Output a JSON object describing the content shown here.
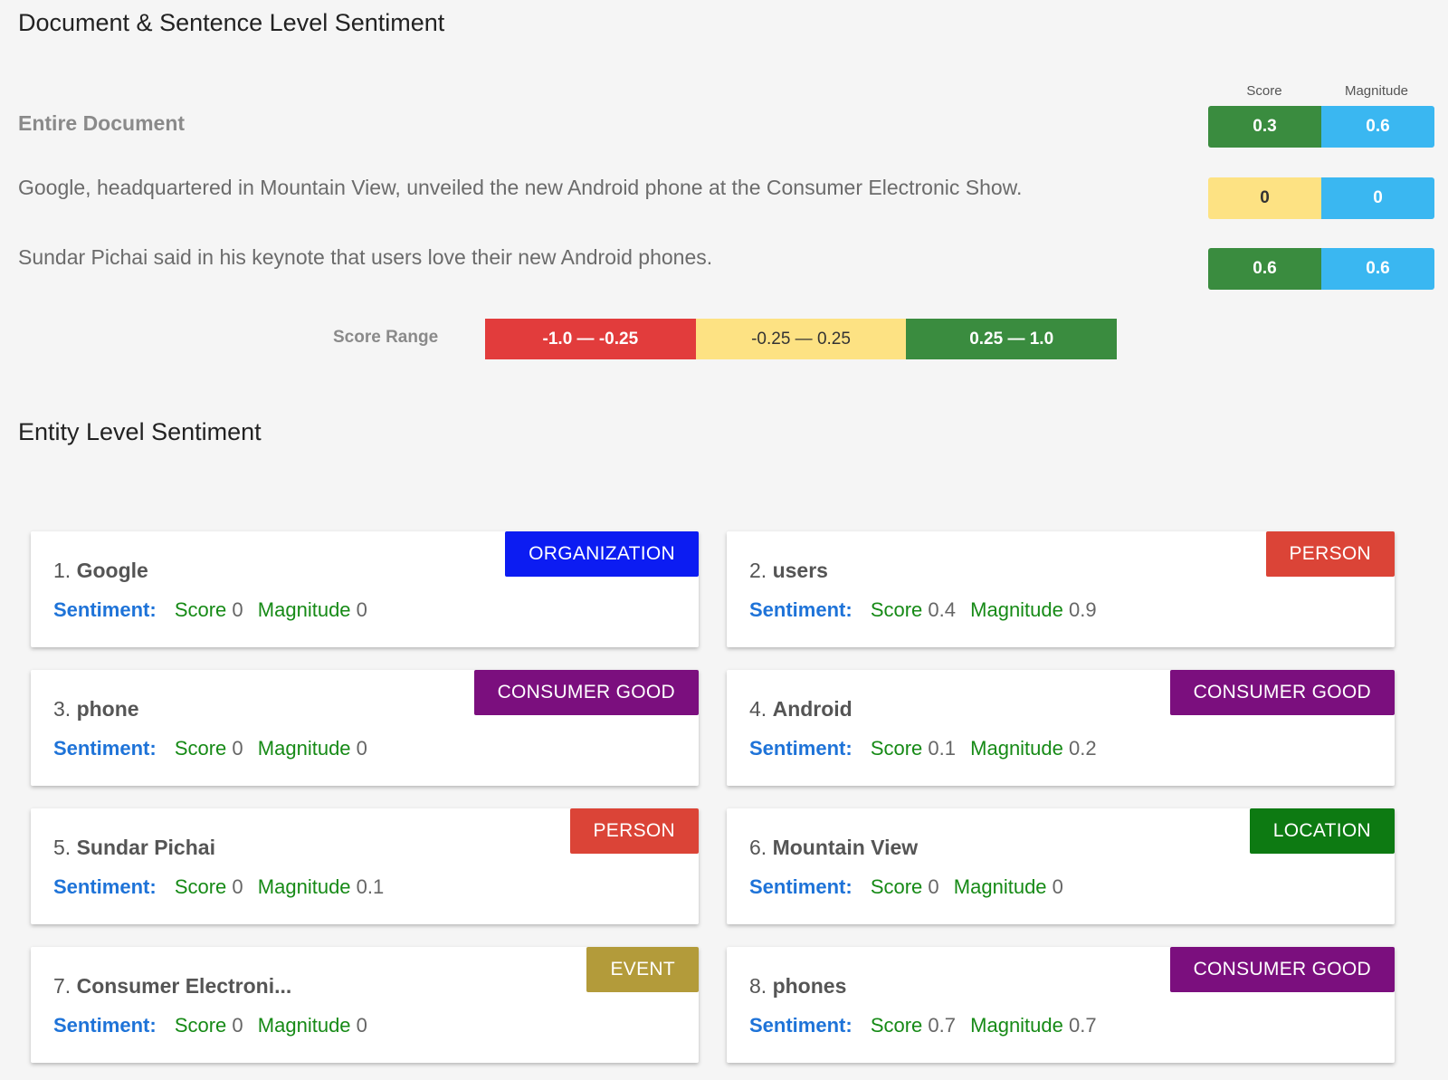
{
  "doc_section": {
    "title": "Document & Sentence Level Sentiment",
    "score_header": "Score",
    "magnitude_header": "Magnitude",
    "entire_document": {
      "label": "Entire Document",
      "score": "0.3",
      "magnitude": "0.6",
      "score_color": "#3a8c3f"
    },
    "sentences": [
      {
        "text": "Google, headquartered in Mountain View, unveiled the new Android phone at the Consumer Electronic Show.",
        "score": "0",
        "magnitude": "0",
        "score_color": "#fde283"
      },
      {
        "text": "Sundar Pichai said in his keynote that users love their new Android phones.",
        "score": "0.6",
        "magnitude": "0.6",
        "score_color": "#3a8c3f"
      }
    ],
    "score_range": {
      "label": "Score Range",
      "negative": "-1.0 — -0.25",
      "neutral": "-0.25 — 0.25",
      "positive": "0.25 — 1.0"
    },
    "magnitude_color": "#3ab7f1"
  },
  "entity_section": {
    "title": "Entity Level Sentiment",
    "sentiment_label": "Sentiment:",
    "score_label": "Score",
    "magnitude_label": "Magnitude",
    "entities": [
      {
        "num": "1.",
        "name": "Google",
        "type": "ORGANIZATION",
        "type_color": "#0c1cf2",
        "score": "0",
        "magnitude": "0"
      },
      {
        "num": "2.",
        "name": "users",
        "type": "PERSON",
        "type_color": "#db4437",
        "score": "0.4",
        "magnitude": "0.9"
      },
      {
        "num": "3.",
        "name": "phone",
        "type": "CONSUMER GOOD",
        "type_color": "#7b0f7e",
        "score": "0",
        "magnitude": "0"
      },
      {
        "num": "4.",
        "name": "Android",
        "type": "CONSUMER GOOD",
        "type_color": "#7b0f7e",
        "score": "0.1",
        "magnitude": "0.2"
      },
      {
        "num": "5.",
        "name": "Sundar Pichai",
        "type": "PERSON",
        "type_color": "#db4437",
        "score": "0",
        "magnitude": "0.1"
      },
      {
        "num": "6.",
        "name": "Mountain View",
        "type": "LOCATION",
        "type_color": "#0d7a12",
        "score": "0",
        "magnitude": "0"
      },
      {
        "num": "7.",
        "name": "Consumer Electroni...",
        "type": "EVENT",
        "type_color": "#b39b3a",
        "score": "0",
        "magnitude": "0"
      },
      {
        "num": "8.",
        "name": "phones",
        "type": "CONSUMER GOOD",
        "type_color": "#7b0f7e",
        "score": "0.7",
        "magnitude": "0.7"
      }
    ]
  }
}
